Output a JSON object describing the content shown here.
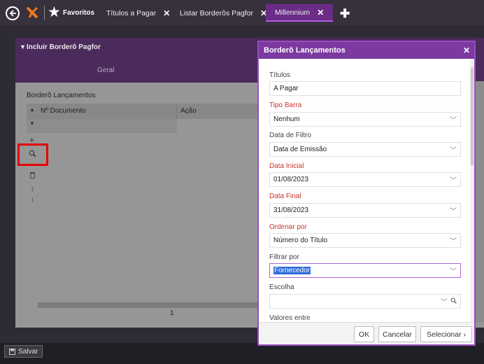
{
  "topbar": {
    "favorites_label": "Favoritos",
    "tabs": [
      {
        "label": "Títulos a Pagar"
      },
      {
        "label": "Listar Borderôs Pagfor"
      },
      {
        "label": "Millennium"
      }
    ],
    "close_glyph": "✕",
    "add_tab_glyph": "✚"
  },
  "page": {
    "panel_title": "Incluir Borderô Pagfor",
    "tab_geral": "Geral",
    "section_label": "Borderô Lançamentos",
    "grid": {
      "columns": [
        "Nº Documento",
        "Ação"
      ],
      "row_numbers": [
        "1",
        "1"
      ],
      "page_number": "1"
    },
    "save_label": "Salvar"
  },
  "modal": {
    "title": "Borderô Lançamentos",
    "close_glyph": "✕",
    "fields": [
      {
        "label": "Títulos",
        "value": "A Pagar",
        "required": false
      },
      {
        "label": "Tipo Barra",
        "value": "Nenhum",
        "required": true
      },
      {
        "label": "Data de Filtro",
        "value": "Data de Emissão",
        "required": false
      },
      {
        "label": "Data Inicial",
        "value": "01/08/2023",
        "required": true
      },
      {
        "label": "Data Final",
        "value": "31/08/2023",
        "required": true
      },
      {
        "label": "Ordenar por",
        "value": "Número do Título",
        "required": true
      },
      {
        "label": "Filtrar por",
        "value": "Fornecedor",
        "required": false
      },
      {
        "label": "Escolha",
        "value": "",
        "required": false
      }
    ],
    "last_label": "Valores entre",
    "buttons": {
      "ok": "OK",
      "cancel": "Cancelar",
      "select": "Selecionar ›"
    }
  },
  "icons": {
    "back": "arrow-left-circle-icon",
    "logo": "millennium-logo-icon",
    "favorites": "star-icon",
    "search": "magnifier-icon",
    "save": "floppy-disk-icon"
  },
  "colors": {
    "accent_purple": "#7c3aa0",
    "required_red": "#c8342a",
    "highlight_red": "#e60000"
  }
}
